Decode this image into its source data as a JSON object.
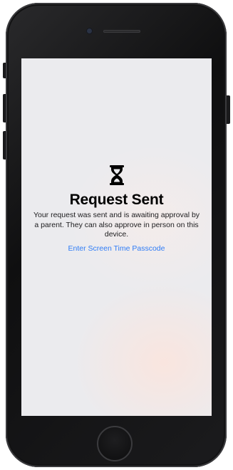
{
  "screen": {
    "icon": "hourglass-icon",
    "title": "Request Sent",
    "message": "Your request was sent and is awaiting approval by a parent. They can also approve in person on this device.",
    "passcode_link": "Enter Screen Time Passcode"
  },
  "colors": {
    "link": "#2f7cf6",
    "screen_background": "#ebebee",
    "device_body": "#1b1b1d"
  }
}
